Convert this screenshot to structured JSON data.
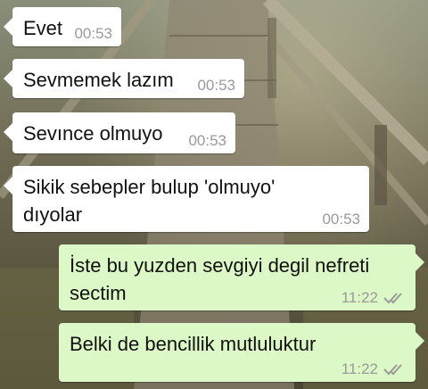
{
  "messages": [
    {
      "direction": "incoming",
      "text": "Evet",
      "time": "00:53"
    },
    {
      "direction": "incoming",
      "text": "Sevmemek lazım",
      "time": "00:53"
    },
    {
      "direction": "incoming",
      "text": "Sevınce olmuyo",
      "time": "00:53"
    },
    {
      "direction": "incoming",
      "text": "Sikik sebepler bulup 'olmuyo'\ndıyolar",
      "time": "00:53"
    },
    {
      "direction": "outgoing",
      "text": "İste bu yuzden sevgiyi degil nefreti\nsectim",
      "time": "11:22",
      "status_icon": "double-check-icon"
    },
    {
      "direction": "outgoing",
      "text": "Belki de bencillik mutluluktur",
      "time": "11:22",
      "status_icon": "double-check-icon"
    }
  ],
  "colors": {
    "incoming_bubble": "#ffffff",
    "outgoing_bubble": "#dcf8c6",
    "time_text": "#9a9a9a"
  }
}
